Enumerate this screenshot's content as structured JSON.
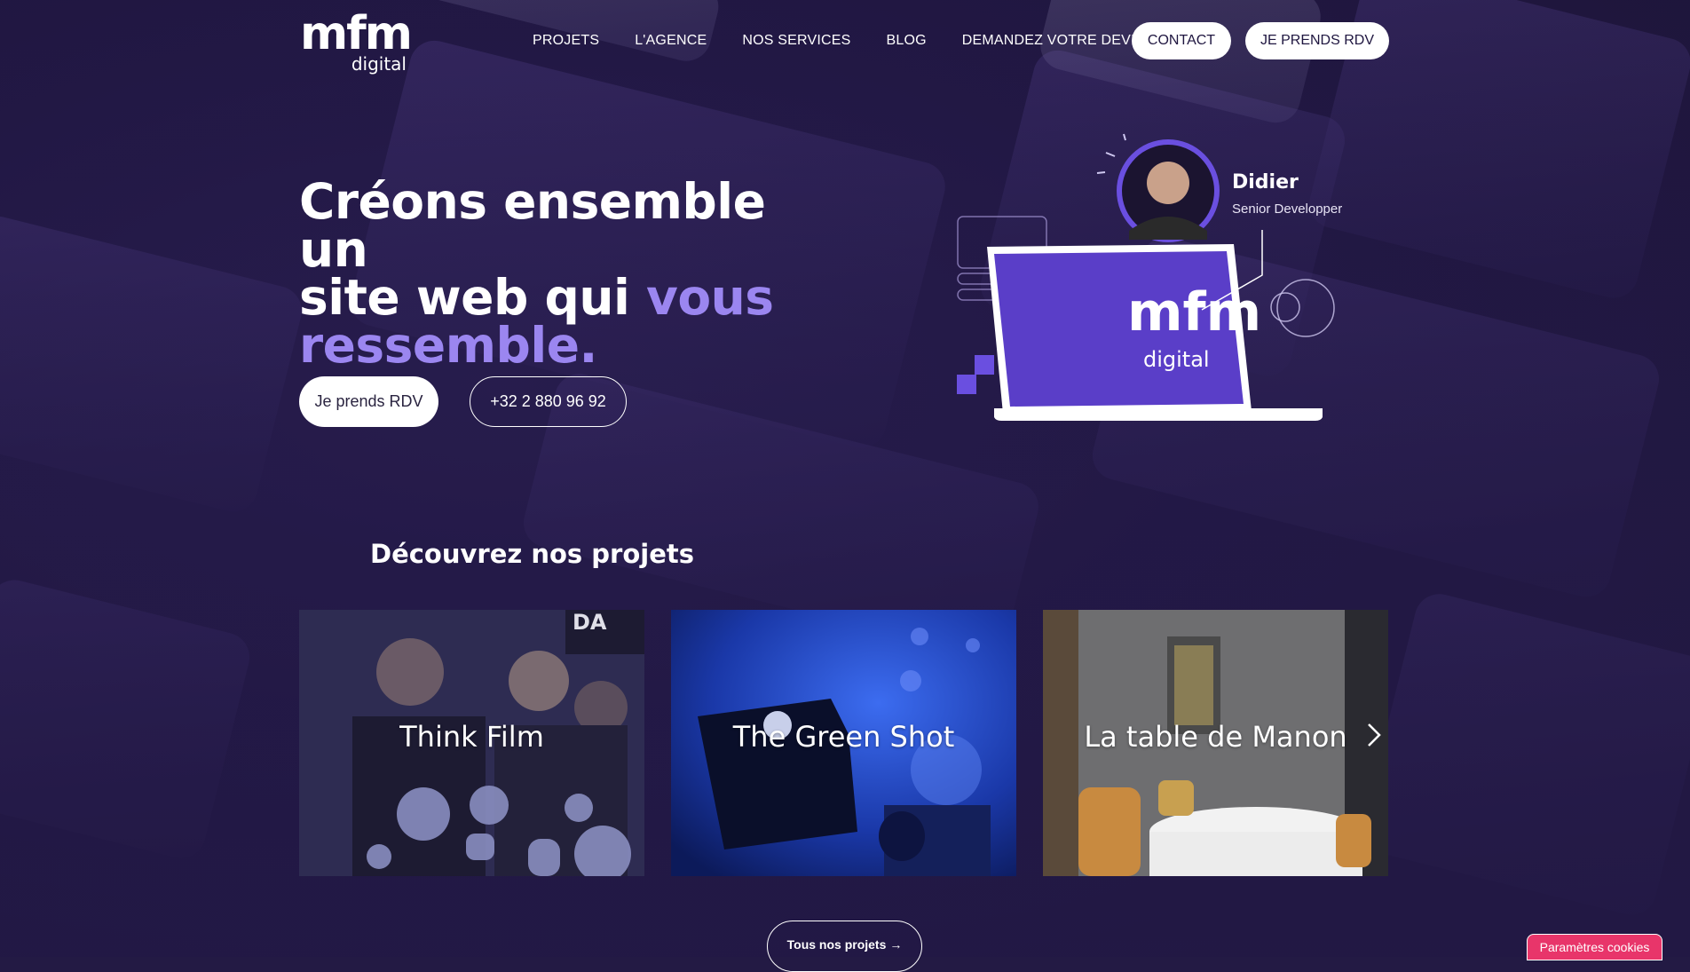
{
  "header": {
    "logo_main": "mfm",
    "logo_sub": "digital",
    "nav": [
      {
        "label": "PROJETS"
      },
      {
        "label": "L'AGENCE"
      },
      {
        "label": "NOS SERVICES"
      },
      {
        "label": "BLOG"
      },
      {
        "label": "DEMANDEZ VOTRE DEVIS"
      }
    ],
    "contact_label": "CONTACT",
    "rdv_label": "JE PRENDS RDV"
  },
  "hero": {
    "title_line1": "Créons ensemble un",
    "title_line2_a": "site web qui ",
    "title_line2_b": "vous",
    "title_line3": "ressemble.",
    "btn_rdv": "Je prends RDV",
    "btn_phone": "+32 2 880 96 92"
  },
  "illustration": {
    "name": "Didier",
    "role": "Senior Developper",
    "screen_logo_main": "mfm",
    "screen_logo_sub": "digital"
  },
  "projects": {
    "title": "Découvrez nos projets",
    "items": [
      {
        "label": "Think Film"
      },
      {
        "label": "The Green Shot"
      },
      {
        "label": "La table de Manon"
      }
    ],
    "all_label": "Tous nos projets"
  },
  "cookies": {
    "label": "Paramètres cookies"
  },
  "colors": {
    "accent": "#9b86f0",
    "background": "#231a44",
    "cookie": "#e8356a"
  }
}
